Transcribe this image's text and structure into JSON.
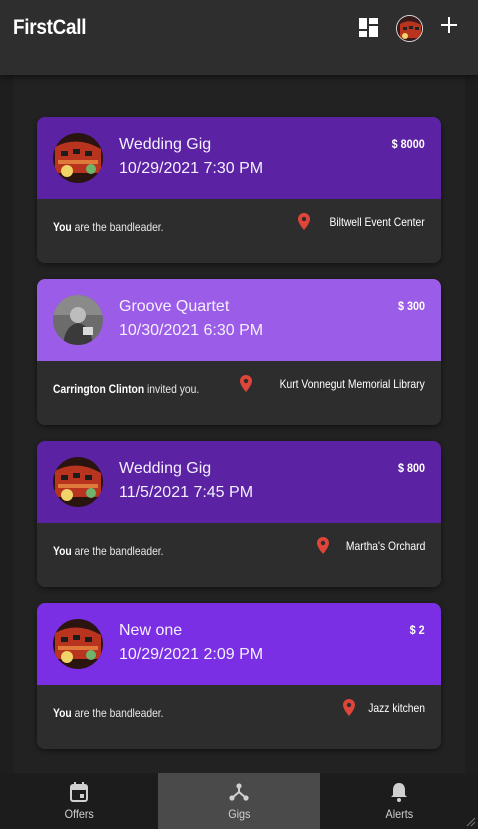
{
  "app": {
    "title": "FirstCall"
  },
  "colors": {
    "topbar": "#2e2e2e",
    "card1": "#5b22a3",
    "card2": "#9b5ce8",
    "card3": "#5b22a3",
    "card4": "#7a2fe4",
    "pin": "#e0453a"
  },
  "gigs": [
    {
      "title": "Wedding Gig",
      "date": "10/29/2021 7:30 PM",
      "price": "$ 8000",
      "who_bold": "You",
      "who_rest": " are the bandleader.",
      "location": "Biltwell Event Center",
      "avatar": "band-photo"
    },
    {
      "title": "Groove Quartet",
      "date": "10/30/2021 6:30 PM",
      "price": "$ 300",
      "who_bold": "Carrington Clinton",
      "who_rest": " invited you.",
      "location": "Kurt Vonnegut Memorial Library",
      "avatar": "person-photo"
    },
    {
      "title": "Wedding Gig",
      "date": "11/5/2021 7:45 PM",
      "price": "$ 800",
      "who_bold": "You",
      "who_rest": " are the bandleader.",
      "location": "Martha's Orchard",
      "avatar": "band-photo"
    },
    {
      "title": "New one",
      "date": "10/29/2021 2:09 PM",
      "price": "$ 2",
      "who_bold": "You",
      "who_rest": " are the bandleader.",
      "location": "Jazz kitchen",
      "avatar": "band-photo"
    }
  ],
  "nav": [
    {
      "label": "Offers",
      "icon": "calendar-icon"
    },
    {
      "label": "Gigs",
      "icon": "hub-icon",
      "active": true
    },
    {
      "label": "Alerts",
      "icon": "bell-icon"
    }
  ]
}
